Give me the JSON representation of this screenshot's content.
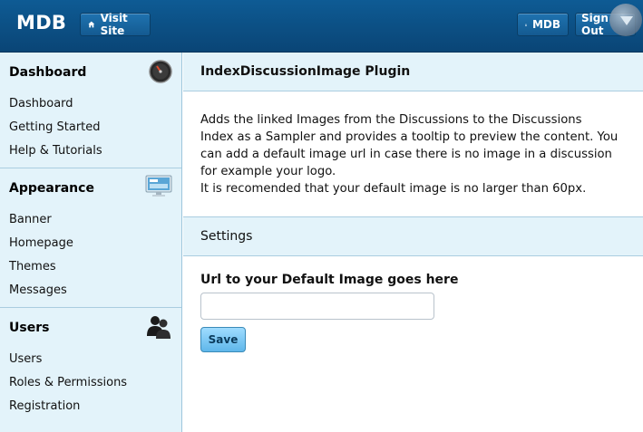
{
  "header": {
    "brand": "MDB",
    "visit_site": "Visit Site",
    "user": "MDB",
    "sign_out": "Sign Out"
  },
  "sidebar": {
    "sections": [
      {
        "title": "Dashboard",
        "icon": "dashboard-gauge-icon",
        "items": [
          "Dashboard",
          "Getting Started",
          "Help & Tutorials"
        ]
      },
      {
        "title": "Appearance",
        "icon": "monitor-icon",
        "items": [
          "Banner",
          "Homepage",
          "Themes",
          "Messages"
        ]
      },
      {
        "title": "Users",
        "icon": "users-icon",
        "items": [
          "Users",
          "Roles & Permissions",
          "Registration"
        ]
      }
    ]
  },
  "main": {
    "title": "IndexDiscussionImage Plugin",
    "description_lines": [
      "Adds the linked Images from the Discussions to the Discussions",
      "Index as a Sampler and provides a tooltip to preview the content. You",
      "can add a default image url in case there is no image in a discussion",
      "for example your logo.",
      "It is recomended that your default image is no larger than 60px."
    ],
    "settings_title": "Settings",
    "field_label": "Url to your Default Image goes here",
    "field_value": "",
    "field_placeholder": "",
    "save_label": "Save"
  },
  "colors": {
    "topbar": "#0a4576",
    "sidebar_bg": "#e3f3fa",
    "divider": "#aacde0",
    "save_button": "#5fb7ea"
  }
}
